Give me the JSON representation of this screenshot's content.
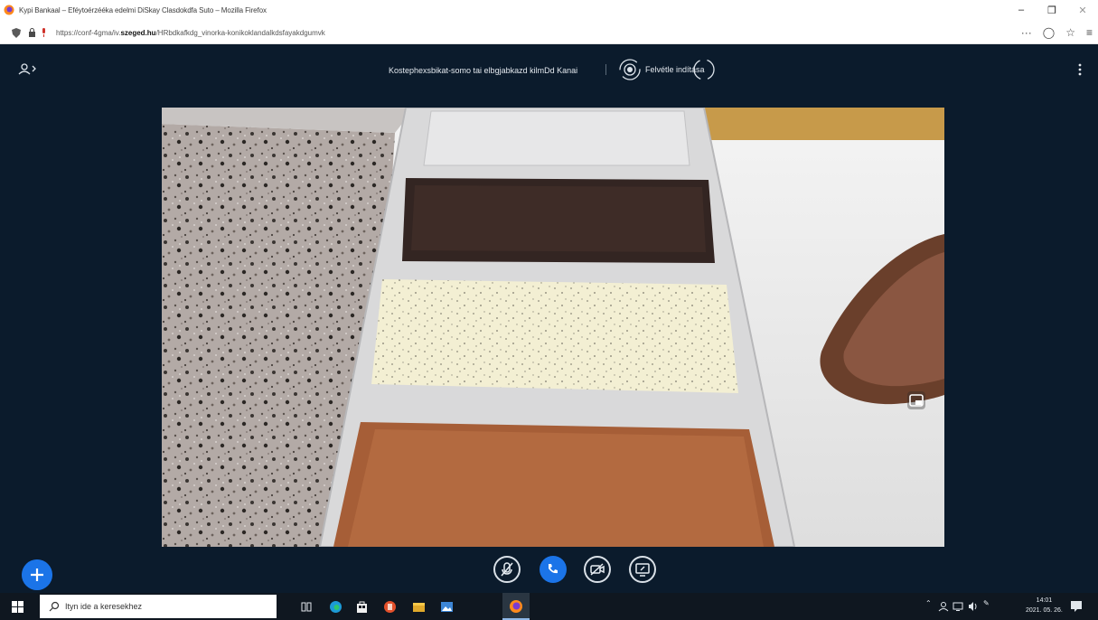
{
  "browser": {
    "window_title": "Kypi Bankaal – Eféytoérzééka edelmi DiSkay Clasdokdfa Suto – Mozilla Firefox",
    "url_prefix": "https://conf-4gma/iv.",
    "url_domain": "szeged.hu",
    "url_suffix": "/HRbdkafkdg_vinorka-konikoklandalkdsfayakdgumvk"
  },
  "meeting": {
    "title": "Kostephexsbikat-somo tai elbgjabkazd kilmDd Kanai",
    "record_label": "Felvétle indítása"
  },
  "taskbar": {
    "search_placeholder": "Ityn ide a keresekhez",
    "clock_time": "14:01",
    "clock_date": "2021. 05. 26."
  },
  "colors": {
    "app_bg": "#0b1b2c",
    "accent_blue": "#1b74e8",
    "taskbar_bg": "#0f1720"
  },
  "icons": {
    "taskbar": [
      "task-view-icon",
      "edge-icon",
      "store-icon",
      "office-icon",
      "explorer-icon",
      "photos-icon",
      "firefox-icon"
    ]
  }
}
